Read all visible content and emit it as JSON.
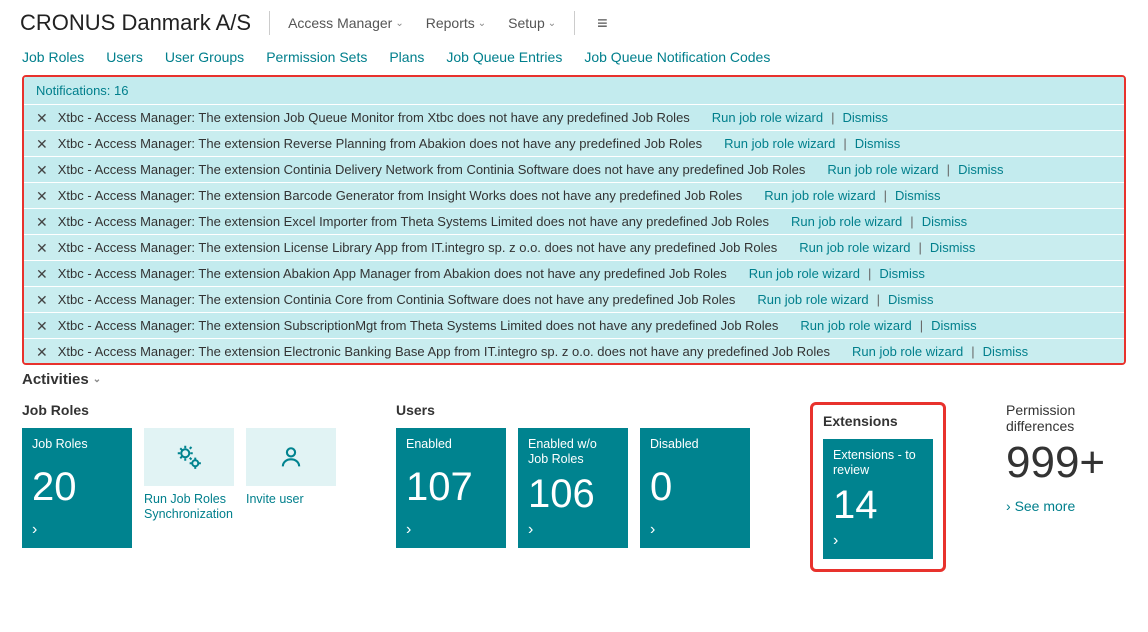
{
  "header": {
    "company": "CRONUS Danmark A/S",
    "menu": [
      "Access Manager",
      "Reports",
      "Setup"
    ]
  },
  "nav": [
    "Job Roles",
    "Users",
    "User Groups",
    "Permission Sets",
    "Plans",
    "Job Queue Entries",
    "Job Queue Notification Codes"
  ],
  "notifications": {
    "count_label": "Notifications: 16",
    "run_label": "Run job role wizard",
    "dismiss_label": "Dismiss",
    "items": [
      "Xtbc - Access Manager: The extension Job Queue Monitor from Xtbc does not have any predefined Job Roles",
      "Xtbc - Access Manager: The extension Reverse Planning from Abakion does not have any predefined Job Roles",
      "Xtbc - Access Manager: The extension Continia Delivery Network from Continia Software does not have any predefined Job Roles",
      "Xtbc - Access Manager: The extension Barcode Generator from Insight Works does not have any predefined Job Roles",
      "Xtbc - Access Manager: The extension Excel Importer from Theta Systems Limited does not have any predefined Job Roles",
      "Xtbc - Access Manager: The extension License Library App from IT.integro sp. z o.o. does not have any predefined Job Roles",
      "Xtbc - Access Manager: The extension Abakion App Manager from Abakion does not have any predefined Job Roles",
      "Xtbc - Access Manager: The extension Continia Core from Continia Software does not have any predefined Job Roles",
      "Xtbc - Access Manager: The extension SubscriptionMgt from Theta Systems Limited does not have any predefined Job Roles",
      "Xtbc - Access Manager: The extension Electronic Banking Base App from IT.integro sp. z o.o. does not have any predefined Job Roles"
    ]
  },
  "activities_label": "Activities",
  "groups": {
    "job_roles": {
      "title": "Job Roles",
      "tile": {
        "label": "Job Roles",
        "value": "20"
      },
      "actions": [
        {
          "label": "Run Job Roles Synchronization",
          "icon": "gears"
        },
        {
          "label": "Invite user",
          "icon": "person"
        }
      ]
    },
    "users": {
      "title": "Users",
      "tiles": [
        {
          "label": "Enabled",
          "value": "107"
        },
        {
          "label": "Enabled w/o Job Roles",
          "value": "106"
        },
        {
          "label": "Disabled",
          "value": "0"
        }
      ]
    },
    "extensions": {
      "title": "Extensions",
      "tile": {
        "label": "Extensions - to review",
        "value": "14"
      }
    },
    "perm": {
      "title": "Permission differences",
      "value": "999+",
      "see_more": "See more"
    }
  }
}
